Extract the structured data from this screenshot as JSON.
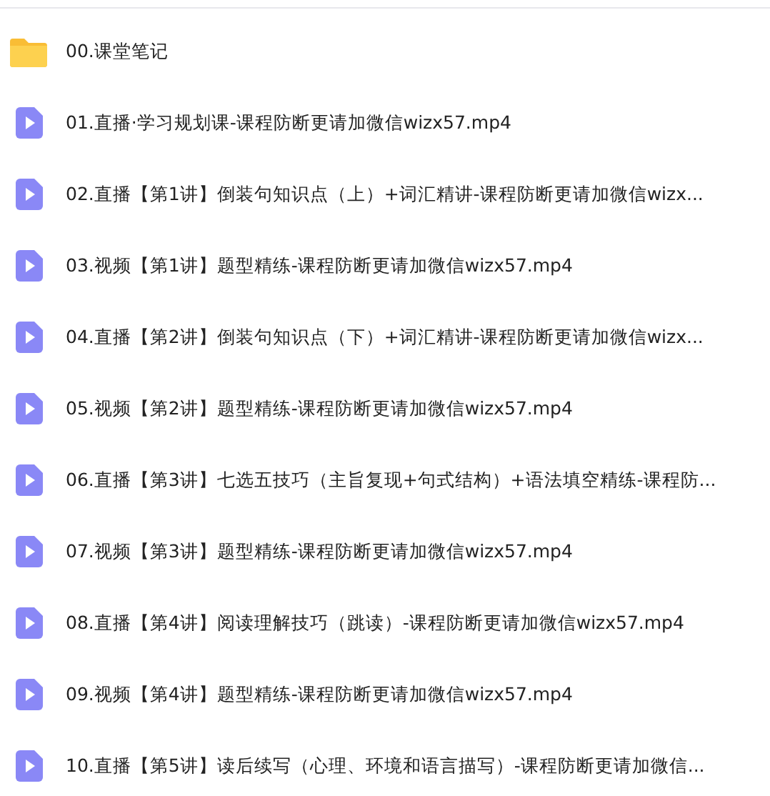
{
  "files": [
    {
      "kind": "folder",
      "name": "00.课堂笔记"
    },
    {
      "kind": "video",
      "name": "01.直播·学习规划课-课程防断更请加微信wizx57.mp4"
    },
    {
      "kind": "video",
      "name": "02.直播【第1讲】倒装句知识点（上）+词汇精讲-课程防断更请加微信wizx..."
    },
    {
      "kind": "video",
      "name": "03.视频【第1讲】题型精练-课程防断更请加微信wizx57.mp4"
    },
    {
      "kind": "video",
      "name": "04.直播【第2讲】倒装句知识点（下）+词汇精讲-课程防断更请加微信wizx..."
    },
    {
      "kind": "video",
      "name": "05.视频【第2讲】题型精练-课程防断更请加微信wizx57.mp4"
    },
    {
      "kind": "video",
      "name": "06.直播【第3讲】七选五技巧（主旨复现+句式结构）+语法填空精练-课程防..."
    },
    {
      "kind": "video",
      "name": "07.视频【第3讲】题型精练-课程防断更请加微信wizx57.mp4"
    },
    {
      "kind": "video",
      "name": "08.直播【第4讲】阅读理解技巧（跳读）-课程防断更请加微信wizx57.mp4"
    },
    {
      "kind": "video",
      "name": "09.视频【第4讲】题型精练-课程防断更请加微信wizx57.mp4"
    },
    {
      "kind": "video",
      "name": "10.直播【第5讲】读后续写（心理、环境和语言描写）-课程防断更请加微信..."
    }
  ]
}
